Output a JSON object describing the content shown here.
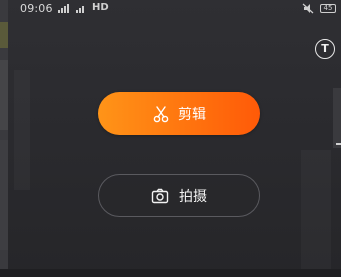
{
  "status_bar": {
    "time": "09:06",
    "network": "HD",
    "battery": "45"
  },
  "tools": {
    "text_tool_symbol": "T"
  },
  "actions": {
    "edit_label": "剪辑",
    "edit_icon": "scissors-icon",
    "shoot_label": "拍摄",
    "shoot_icon": "camera-icon"
  },
  "colors": {
    "accent_start": "#ff9418",
    "accent_end": "#ff5a08",
    "background": "#2c2c30"
  }
}
